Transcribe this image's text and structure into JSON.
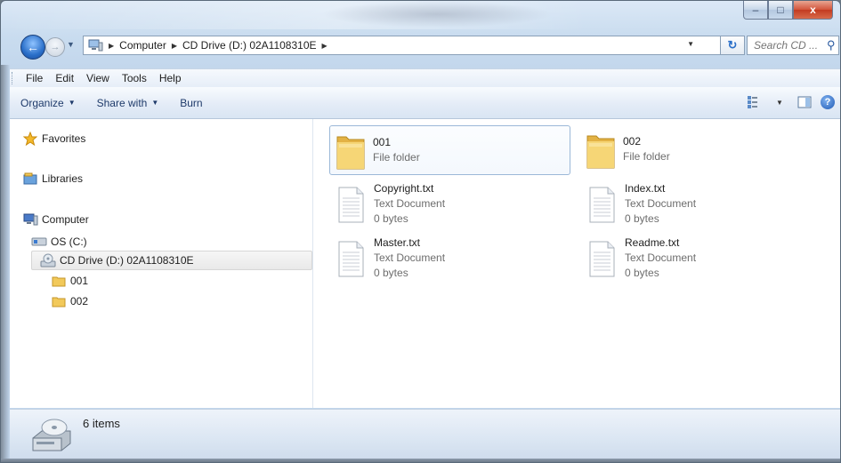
{
  "window": {
    "controls": {
      "minimize": "–",
      "maximize": "□",
      "close": "x"
    }
  },
  "address": {
    "crumbs": [
      "Computer",
      "CD Drive (D:) 02A1108310E"
    ],
    "search_placeholder": "Search CD ..."
  },
  "menu": {
    "items": [
      "File",
      "Edit",
      "View",
      "Tools",
      "Help"
    ]
  },
  "toolbar": {
    "organize": "Organize",
    "share_with": "Share with",
    "burn": "Burn"
  },
  "sidebar": {
    "favorites": "Favorites",
    "libraries": "Libraries",
    "computer": "Computer",
    "os_drive": "OS (C:)",
    "cd_drive": "CD Drive (D:) 02A1108310E",
    "folders": [
      "001",
      "002"
    ]
  },
  "files": [
    {
      "name": "001",
      "type": "File folder",
      "size": ""
    },
    {
      "name": "002",
      "type": "File folder",
      "size": ""
    },
    {
      "name": "Copyright.txt",
      "type": "Text Document",
      "size": "0 bytes"
    },
    {
      "name": "Index.txt",
      "type": "Text Document",
      "size": "0 bytes"
    },
    {
      "name": "Master.txt",
      "type": "Text Document",
      "size": "0 bytes"
    },
    {
      "name": "Readme.txt",
      "type": "Text Document",
      "size": "0 bytes"
    }
  ],
  "status": {
    "item_count": "6 items"
  },
  "colors": {
    "accent": "#2a6fc9",
    "folder": "#f2c95a",
    "selection_border": "#9bb8d8"
  }
}
